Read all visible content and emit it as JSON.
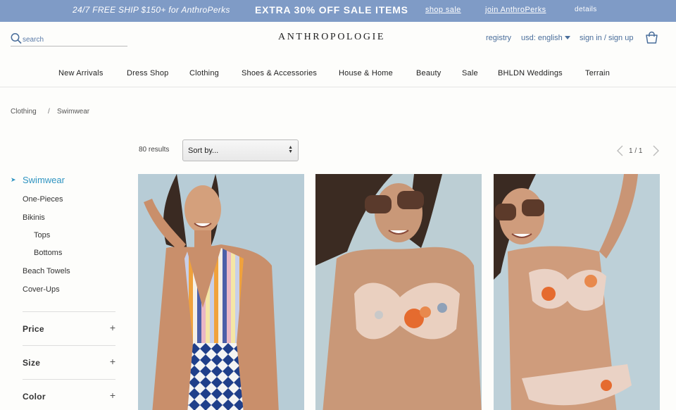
{
  "promo": {
    "shipping": "24/7 FREE SHIP $150+ for AnthroPerks",
    "sale": "EXTRA 30% OFF SALE ITEMS",
    "shop_sale": "shop sale",
    "join": "join AnthroPerks",
    "details": "details"
  },
  "header": {
    "search_placeholder": "search",
    "logo": "ANTHROPOLOGIE",
    "registry": "registry",
    "currency": "usd: english",
    "signin": "sign in / sign up"
  },
  "nav": [
    "New Arrivals",
    "Dress Shop",
    "Clothing",
    "Shoes & Accessories",
    "House & Home",
    "Beauty",
    "Sale",
    "BHLDN Weddings",
    "Terrain"
  ],
  "breadcrumb": [
    "Clothing",
    "Swimwear"
  ],
  "breadcrumb_sep": "/",
  "toolbar": {
    "results": "80 results",
    "sort_label": "Sort by...",
    "page": "1 / 1"
  },
  "sidebar": {
    "active": "Swimwear",
    "items": [
      "One-Pieces",
      "Bikinis",
      "Tops",
      "Bottoms",
      "Beach Towels",
      "Cover-Ups"
    ],
    "filters": [
      "Price",
      "Size",
      "Color"
    ]
  },
  "icons": {
    "search": "search-icon",
    "bag": "shopping-bag-icon",
    "prev": "chevron-left-icon",
    "next": "chevron-right-icon",
    "active": "triangle-right-icon",
    "filter": "plus-icon"
  },
  "colors": {
    "promo_bg": "#7f9bc6",
    "accent": "#2f94c1",
    "link": "#4a6e9b"
  }
}
